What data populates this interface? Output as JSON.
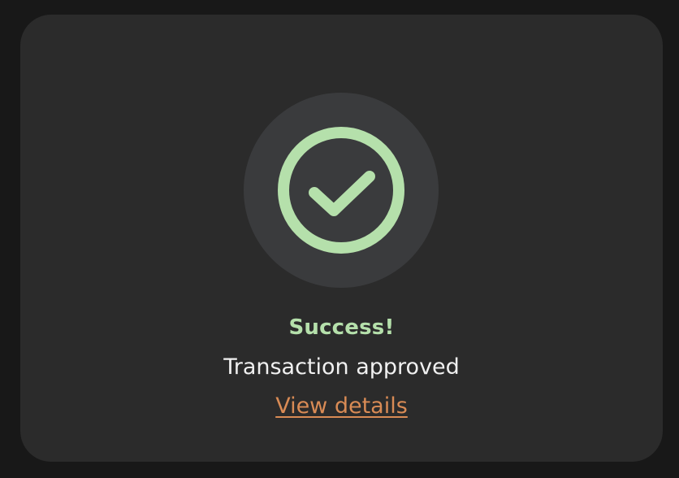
{
  "status": {
    "icon": "check-circle-icon",
    "title": "Success!",
    "message": "Transaction approved",
    "link_label": "View details"
  },
  "colors": {
    "success": "#b5e0ab",
    "link": "#d98b55",
    "icon_bg": "#3a3b3d",
    "card_bg": "#2b2b2b",
    "page_bg": "#181818"
  }
}
